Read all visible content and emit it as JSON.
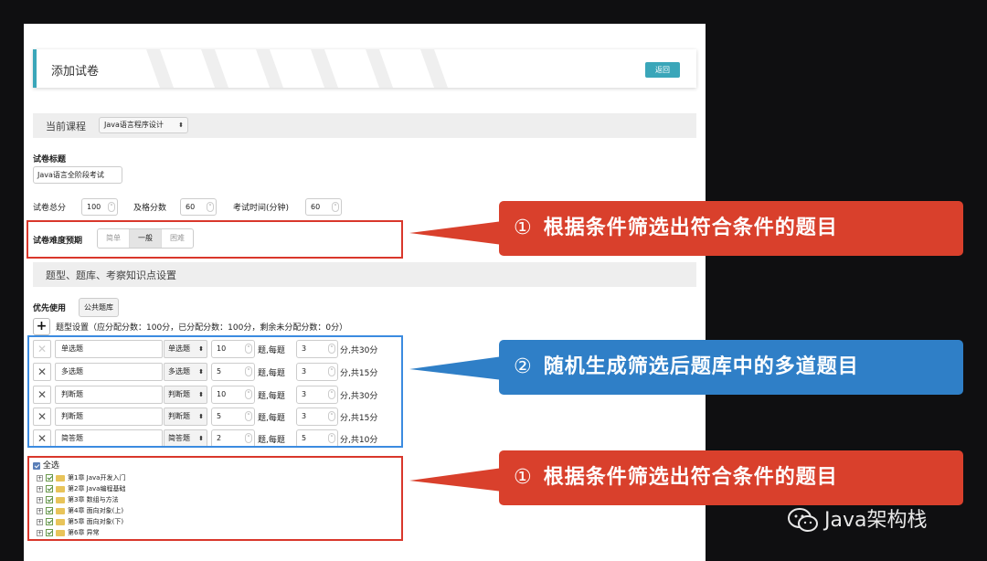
{
  "header": {
    "title": "添加试卷",
    "back_label": "返回"
  },
  "course": {
    "label": "当前课程",
    "selected": "Java语言程序设计"
  },
  "paper_title": {
    "label": "试卷标题",
    "value": "Java语言全阶段考试"
  },
  "scores": {
    "total_label": "试卷总分",
    "total_value": "100",
    "pass_label": "及格分数",
    "pass_value": "60",
    "time_label": "考试时间(分钟)",
    "time_value": "60"
  },
  "difficulty": {
    "label": "试卷难度预期",
    "options": [
      "简单",
      "一般",
      "困难"
    ],
    "selected": "一般"
  },
  "section2": {
    "label": "题型、题库、考察知识点设置"
  },
  "priority": {
    "label": "优先使用",
    "bank_button": "公共题库"
  },
  "question_settings": {
    "add_icon": "plus-icon",
    "summary": "题型设置（应分配分数：100分，已分配分数：100分，剩余未分配分数：0分）",
    "rows": [
      {
        "name": "单选题",
        "type": "单选题",
        "count": "10",
        "per_label": "题,每题",
        "points": "3",
        "total": "分,共30分"
      },
      {
        "name": "多选题",
        "type": "多选题",
        "count": "5",
        "per_label": "题,每题",
        "points": "3",
        "total": "分,共15分"
      },
      {
        "name": "判断题",
        "type": "判断题",
        "count": "10",
        "per_label": "题,每题",
        "points": "3",
        "total": "分,共30分"
      },
      {
        "name": "判断题",
        "type": "判断题",
        "count": "5",
        "per_label": "题,每题",
        "points": "3",
        "total": "分,共15分"
      },
      {
        "name": "简答题",
        "type": "简答题",
        "count": "2",
        "per_label": "题,每题",
        "points": "5",
        "total": "分,共10分"
      }
    ]
  },
  "tree": {
    "select_all": "全选",
    "items": [
      "第1章 Java开发入门",
      "第2章 Java编程基础",
      "第3章 数组与方法",
      "第4章 面向对象(上)",
      "第5章 面向对象(下)",
      "第6章 异常"
    ]
  },
  "callouts": [
    {
      "num": "①",
      "text": "根据条件筛选出符合条件的题目",
      "color": "#d9402c"
    },
    {
      "num": "②",
      "text": "随机生成筛选后题库中的多道题目",
      "color": "#2f7fc7"
    },
    {
      "num": "①",
      "text": "根据条件筛选出符合条件的题目",
      "color": "#d9402c"
    }
  ],
  "watermark": {
    "icon": "wechat-icon",
    "text": "Java架构栈"
  }
}
